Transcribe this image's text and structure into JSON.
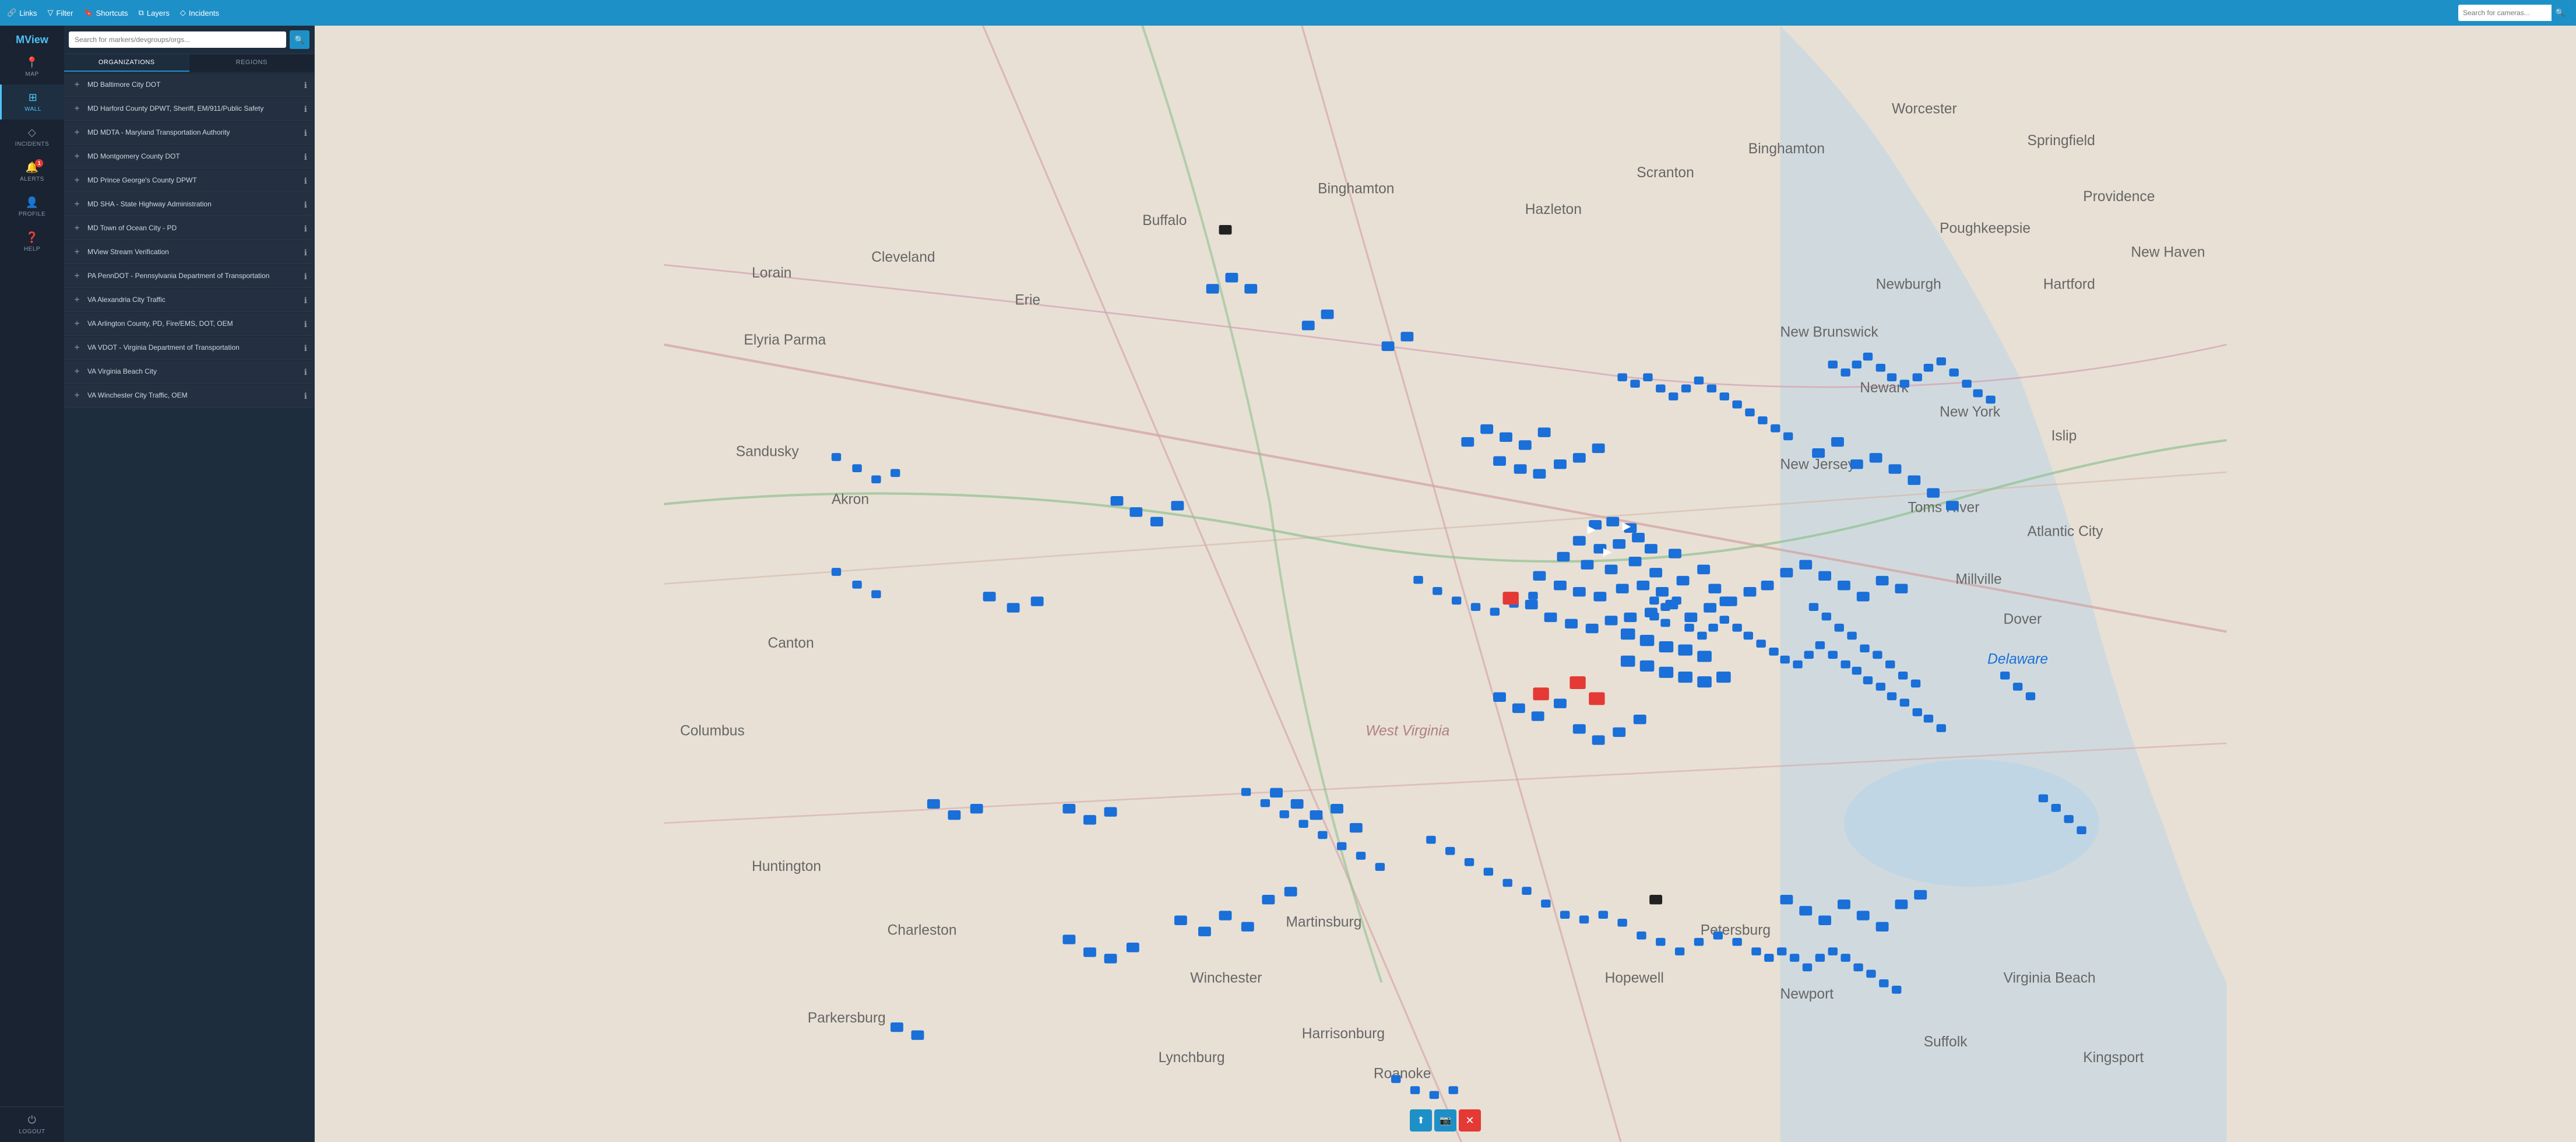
{
  "app": {
    "title": "MView"
  },
  "top_nav": {
    "links_label": "Links",
    "filter_label": "Filter",
    "shortcuts_label": "Shortcuts",
    "layers_label": "Layers",
    "incidents_label": "Incidents",
    "search_placeholder": "Search for cameras...",
    "search_btn_icon": "🔍"
  },
  "sidebar": {
    "items": [
      {
        "id": "map",
        "label": "MAP",
        "icon": "📍",
        "active": false
      },
      {
        "id": "wall",
        "label": "WALL",
        "icon": "⊞",
        "active": true
      },
      {
        "id": "incidents",
        "label": "INCIDENTS",
        "icon": "◇",
        "active": false
      },
      {
        "id": "alerts",
        "label": "ALERTS",
        "icon": "🔔",
        "active": false,
        "badge": "1"
      },
      {
        "id": "profile",
        "label": "PROFILE",
        "icon": "👤",
        "active": false
      },
      {
        "id": "help",
        "label": "HELP",
        "icon": "?",
        "active": false
      }
    ],
    "logout_label": "LOGOUT",
    "logout_icon": "⏻"
  },
  "panel": {
    "search_placeholder": "Search for markers/devgroups/orgs...",
    "tabs": [
      {
        "id": "organizations",
        "label": "ORGANIZATIONS",
        "active": true
      },
      {
        "id": "regions",
        "label": "REGIONS",
        "active": false
      }
    ],
    "items": [
      {
        "id": 1,
        "label": "MD Baltimore City DOT"
      },
      {
        "id": 2,
        "label": "MD Harford County DPWT, Sheriff, EM/911/Public Safety"
      },
      {
        "id": 3,
        "label": "MD MDTA - Maryland Transportation Authority"
      },
      {
        "id": 4,
        "label": "MD Montgomery County DOT"
      },
      {
        "id": 5,
        "label": "MD Prince George's County DPWT"
      },
      {
        "id": 6,
        "label": "MD SHA - State Highway Administration"
      },
      {
        "id": 7,
        "label": "MD Town of Ocean City - PD"
      },
      {
        "id": 8,
        "label": "MView Stream Verification"
      },
      {
        "id": 9,
        "label": "PA PennDOT - Pennsylvania Department of Transportation"
      },
      {
        "id": 10,
        "label": "VA Alexandria City Traffic"
      },
      {
        "id": 11,
        "label": "VA Arlington County, PD, Fire/EMS, DOT, OEM"
      },
      {
        "id": 12,
        "label": "VA VDOT - Virginia Department of Transportation"
      },
      {
        "id": 13,
        "label": "VA Virginia Beach City"
      },
      {
        "id": 14,
        "label": "VA Winchester City Traffic, OEM"
      }
    ]
  },
  "map_controls": [
    {
      "id": "up",
      "icon": "⬆",
      "type": "nav"
    },
    {
      "id": "camera",
      "icon": "📷",
      "type": "nav"
    },
    {
      "id": "close",
      "icon": "✕",
      "type": "close"
    }
  ],
  "colors": {
    "accent": "#1e90c8",
    "sidebar_bg": "#1a2332",
    "panel_bg": "#1e2d3e",
    "item_bg": "#243040",
    "active": "#4fc3f7",
    "badge": "#e53935",
    "map_marker": "#1a6fd8",
    "map_marker_alert": "#e53935"
  }
}
